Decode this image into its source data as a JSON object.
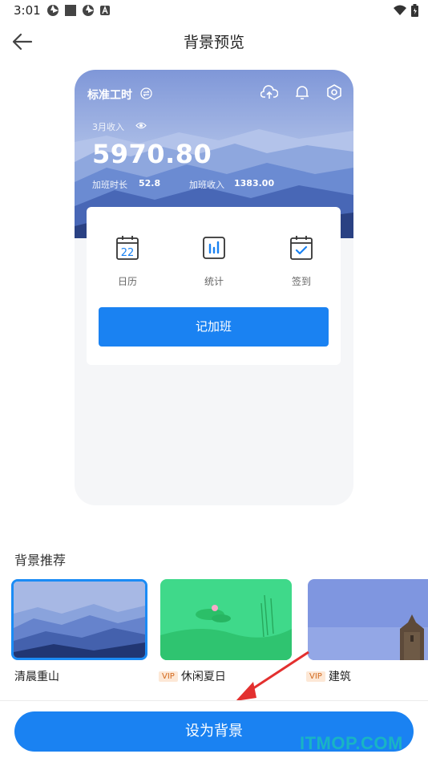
{
  "status": {
    "time": "3:01"
  },
  "header": {
    "title": "背景预览"
  },
  "preview": {
    "app_title": "标准工时",
    "month_label": "3月收入",
    "income": "5970.80",
    "ot_hours_label": "加班时长",
    "ot_hours_value": "52.8",
    "ot_income_label": "加班收入",
    "ot_income_value": "1383.00",
    "features": [
      {
        "label": "日历",
        "icon": "calendar-icon",
        "calendar_day": "22"
      },
      {
        "label": "统计",
        "icon": "stats-icon"
      },
      {
        "label": "签到",
        "icon": "check-in-icon"
      }
    ],
    "record_button": "记加班"
  },
  "recommend": {
    "title": "背景推荐",
    "items": [
      {
        "label": "清晨重山",
        "vip": false,
        "selected": true
      },
      {
        "label": "休闲夏日",
        "vip": true,
        "vip_text": "VIP"
      },
      {
        "label": "建筑",
        "vip": true,
        "vip_text": "VIP"
      }
    ]
  },
  "footer": {
    "set_button": "设为背景"
  },
  "watermark": "ITMOP.COM",
  "colors": {
    "accent": "#1a82f2",
    "selected_border": "#1a8bf5",
    "vip_text": "#d2691e",
    "vip_bg": "#fde8d6"
  }
}
